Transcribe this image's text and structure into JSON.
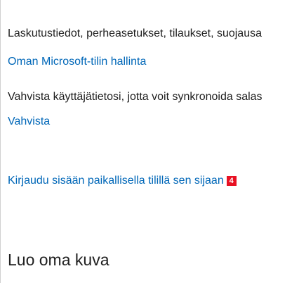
{
  "account": {
    "info_text": "Laskutustiedot, perheasetukset, tilaukset, suojausa",
    "manage_link": "Oman Microsoft-tilin hallinta",
    "verify_text": "Vahvista käyttäjätietosi, jotta voit synkronoida salas",
    "verify_link": "Vahvista",
    "local_account_link": "Kirjaudu sisään paikallisella tilillä sen sijaan",
    "callout_number": "4",
    "callout_color": "#e81123",
    "link_color": "#0067b8"
  },
  "picture": {
    "heading": "Luo oma kuva"
  }
}
